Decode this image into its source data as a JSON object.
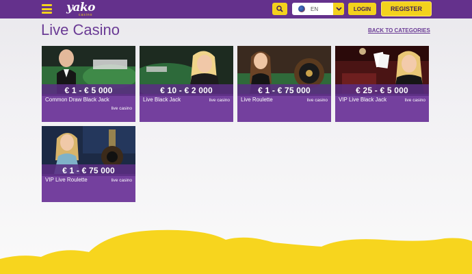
{
  "header": {
    "brand": "yako",
    "brand_sub": "casino",
    "language": "EN",
    "login_label": "LOGIN",
    "register_label": "REGISTER"
  },
  "page": {
    "title": "Live Casino",
    "back_link": "BACK TO CATEGORIES"
  },
  "games": [
    {
      "name": "Common Draw Black Jack",
      "limits": "€ 1 - € 5 000",
      "category": "live casino"
    },
    {
      "name": "Live Black Jack",
      "limits": "€ 10 - € 2 000",
      "category": "live casino"
    },
    {
      "name": "Live Roulette",
      "limits": "€ 1 - € 75 000",
      "category": "live casino"
    },
    {
      "name": "VIP Live Black Jack",
      "limits": "€ 25 - € 5 000",
      "category": "live casino"
    },
    {
      "name": "VIP Live Roulette",
      "limits": "€ 1 - € 75 000",
      "category": "live casino"
    }
  ],
  "colors": {
    "brand_purple": "#64318c",
    "accent_yellow": "#f3d21d",
    "card_purple": "#74409e"
  },
  "icons": {
    "menu": "hamburger-menu-icon",
    "search": "search-icon",
    "language": "globe-flag-icon",
    "dropdown": "chevron-down-icon"
  }
}
